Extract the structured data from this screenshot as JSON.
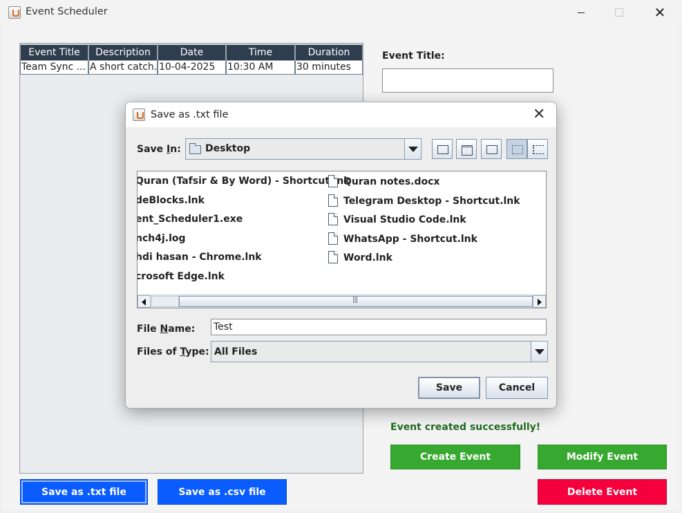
{
  "window": {
    "title": "Event Scheduler",
    "icon": "java-cup-icon"
  },
  "table": {
    "columns": [
      "Event Title",
      "Description",
      "Date",
      "Time",
      "Duration"
    ],
    "rows": [
      [
        "Team Sync ...",
        "A short catch...",
        "10-04-2025",
        "10:30 AM",
        "30 minutes"
      ]
    ]
  },
  "form": {
    "event_title_label": "Event Title:",
    "event_title_value": ""
  },
  "status": {
    "message": "Event created successfully!",
    "color": "#1f6b1f"
  },
  "buttons": {
    "create": "Create Event",
    "modify": "Modify Event",
    "delete": "Delete Event",
    "save_txt": "Save as .txt file",
    "save_csv": "Save as .csv file"
  },
  "colors": {
    "green": "#37a830",
    "red": "#f5003c",
    "blue": "#0a5cff",
    "table_header": "#2f3e4e"
  },
  "dialog": {
    "title": "Save as .txt file",
    "save_in_label_pre": "Save ",
    "save_in_label_ul": "I",
    "save_in_label_post": "n:",
    "save_in_value": "Desktop",
    "files_left": [
      "Quran (Tafsir & By Word) - Shortcut.lnk",
      "deBlocks.lnk",
      "ent_Scheduler1.exe",
      "nch4j.log",
      "hdi hasan - Chrome.lnk",
      "crosoft Edge.lnk"
    ],
    "files_right": [
      "Quran notes.docx",
      "Telegram Desktop - Shortcut.lnk",
      "Visual Studio Code.lnk",
      "WhatsApp - Shortcut.lnk",
      "Word.lnk"
    ],
    "file_name_label_pre": "File ",
    "file_name_label_ul": "N",
    "file_name_label_post": "ame:",
    "file_name_value": "Test",
    "file_type_label_pre": "Files of ",
    "file_type_label_ul": "T",
    "file_type_label_post": "ype:",
    "file_type_value": "All Files",
    "save_button": "Save",
    "cancel_button": "Cancel"
  }
}
